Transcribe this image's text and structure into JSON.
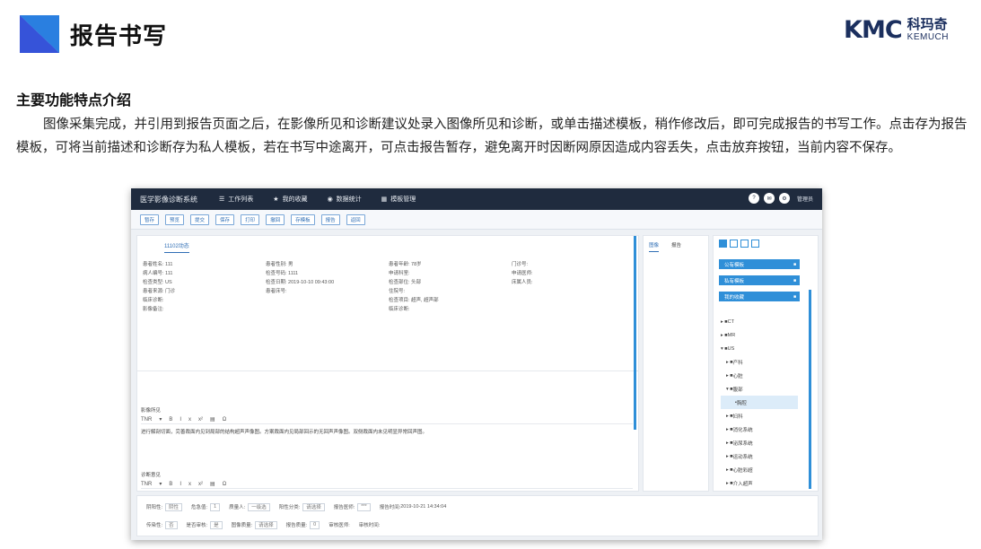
{
  "slide": {
    "title": "报告书写",
    "logo_mark": "KMC",
    "logo_cn": "科玛奇",
    "logo_en": "KEMUCH",
    "section_title": "主要功能特点介绍",
    "description": "图像采集完成，并引用到报告页面之后，在影像所见和诊断建议处录入图像所见和诊断，或单击描述模板，稍作修改后，即可完成报告的书写工作。点击存为报告模板，可将当前描述和诊断存为私人模板，若在书写中途离开，可点击报告暂存，避免离开时因断网原因造成内容丢失，点击放弃按钮，当前内容不保存。"
  },
  "app": {
    "name": "医学影像诊断系统",
    "nav": [
      {
        "icon": "list-icon",
        "label": "工作列表"
      },
      {
        "icon": "star-icon",
        "label": "我的收藏"
      },
      {
        "icon": "stats-icon",
        "label": "数据统计"
      },
      {
        "icon": "template-icon",
        "label": "模板管理"
      }
    ],
    "user": "管理员",
    "toolbar": [
      "暂存",
      "预览",
      "提交",
      "保存",
      "打印",
      "撤回",
      "存模板",
      "报告",
      "返回"
    ],
    "tab": "11102动态",
    "info_rows": [
      [
        "患者姓名: 111",
        "患者性别: 男",
        "患者年龄: 78岁",
        "门诊号:"
      ],
      [
        "病人编号: 111",
        "检查号码: 1111",
        "申请科室:",
        "申请医师:"
      ],
      [
        "检查类型: US",
        "检查日期: 2019-10-10 09:43:00",
        "检查部位: 头部",
        "床属人员:"
      ],
      [
        "患者来源: 门诊",
        "患者床号:",
        "住院号:",
        ""
      ],
      [
        "临床诊断:",
        "",
        "检查项目: 超声, 超声部",
        ""
      ],
      [
        "影像备注:",
        "",
        "临床诊断:",
        ""
      ]
    ],
    "findings_label": "影像所见",
    "findings_text": "进行解剖切面，完善裁面内见到局部的结构超声声像图。方案裁面内见局部回示的无回声声像图。双侧裁面内未见明显异常回声图。",
    "diagnosis_label": "诊断意见",
    "editor_font": "TNR",
    "mid_tabs": [
      "图像",
      "报告"
    ],
    "right_buttons": [
      "公有模板",
      "私有模板",
      "我的收藏"
    ],
    "tree": [
      "CT",
      "MR",
      "US",
      "产科",
      "心脏",
      "腹部",
      "胸腔",
      "妇科",
      "消化系统",
      "泌尿系统",
      "运动系统",
      "心脏彩超",
      "介入超声"
    ],
    "tree_selected": "胸腔",
    "bottom_row1": [
      {
        "label": "阴阳性:",
        "value": "阴性"
      },
      {
        "label": "危急值:",
        "value": "1"
      },
      {
        "label": "质量人:",
        "value": "一级选"
      },
      {
        "label": "阳性分类:",
        "value": "请选择"
      },
      {
        "label": "报告医师:",
        "value": "***"
      },
      {
        "label": "报告时间:",
        "value": "2019-10-21 14:34:04"
      }
    ],
    "bottom_row2": [
      {
        "label": "传染性:",
        "value": "否"
      },
      {
        "label": "是否审核:",
        "value": "是"
      },
      {
        "label": "图像质量:",
        "value": "请选择"
      },
      {
        "label": "报告质量:",
        "value": "0"
      },
      {
        "label": "审核医师:",
        "value": ""
      },
      {
        "label": "审核时间:",
        "value": ""
      }
    ]
  }
}
